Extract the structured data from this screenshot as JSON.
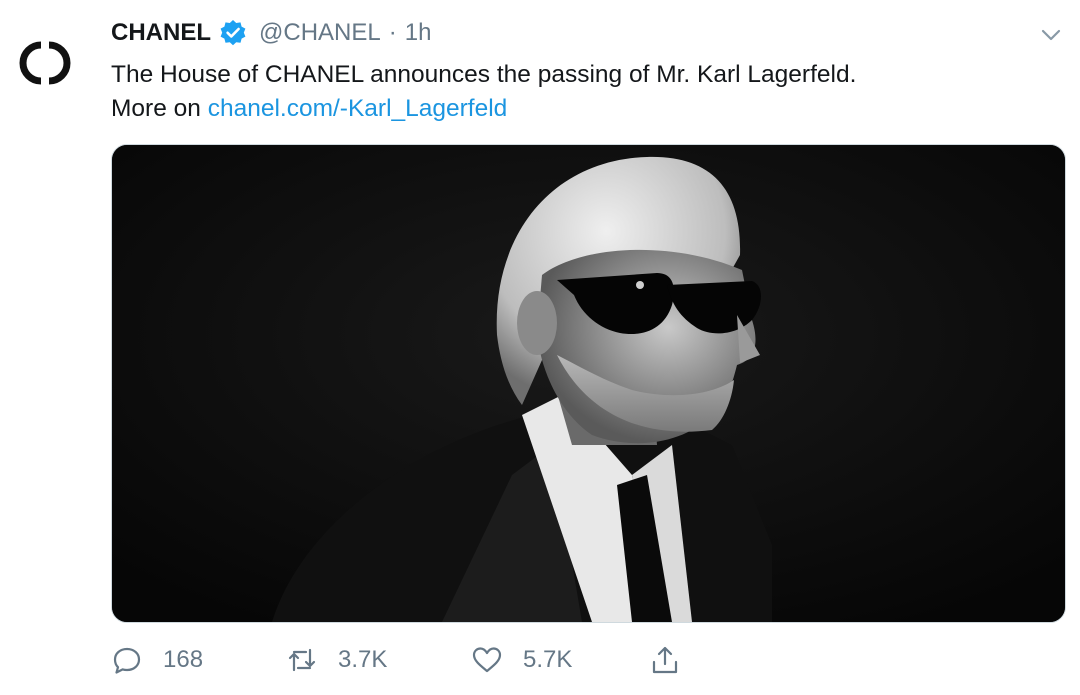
{
  "tweet": {
    "author_name": "CHANEL",
    "handle": "@CHANEL",
    "separator": "·",
    "time": "1h",
    "text_line1": "The House of CHANEL announces the passing of Mr. Karl Lagerfeld.",
    "text_prefix": "More on ",
    "link_text": "chanel.com/-Karl_Lagerfeld",
    "avatar_icon": "chanel-cc-logo-icon",
    "verified_icon": "verified-badge-icon",
    "media_description_icon": "portrait-photo"
  },
  "actions": {
    "reply_count": "168",
    "retweet_count": "3.7K",
    "like_count": "5.7K"
  },
  "colors": {
    "link": "#1b95e0",
    "muted": "#657786",
    "verified": "#1da1f2",
    "text": "#14171a"
  }
}
